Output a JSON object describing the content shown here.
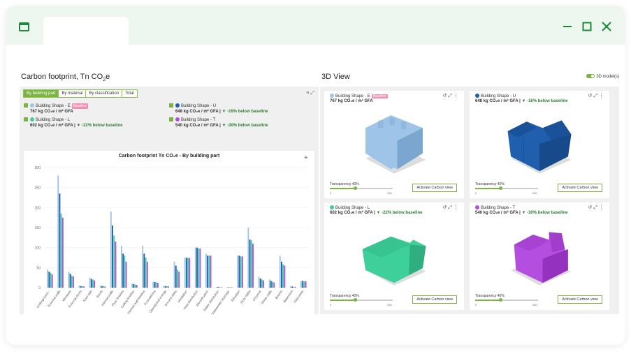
{
  "window": {
    "controls": {
      "minimize": "minimize-icon",
      "maximize": "maximize-icon",
      "close": "close-icon"
    },
    "accent": "#1b8a3a"
  },
  "left_panel": {
    "title": "Carbon footprint, Tn CO",
    "title_sub": "2",
    "title_suffix": "e",
    "tabs": [
      "By building part",
      "By material",
      "By classification",
      "Total"
    ],
    "active_tab": 0,
    "legend": [
      {
        "name": "Building Shape - E",
        "color": "#9ec4e8",
        "badge": "Baseline",
        "value": "767 kg CO₂e / m² GFA",
        "delta": ""
      },
      {
        "name": "Building Shape - U",
        "color": "#1f5fae",
        "badge": "",
        "value": "648 kg CO₂e / m² GFA | ",
        "delta": "▼ -16% below baseline"
      },
      {
        "name": "Building Shape - L",
        "color": "#3ecf9a",
        "badge": "",
        "value": "602 kg CO₂e / m² GFA | ",
        "delta": "▼ -22% below baseline"
      },
      {
        "name": "Building Shape - T",
        "color": "#b44ee0",
        "badge": "",
        "value": "540 kg CO₂e / m² GFA | ",
        "delta": "▼ -30% below baseline"
      }
    ]
  },
  "chart_data": {
    "type": "bar",
    "title": "Carbon footprint Tn CO₂e - By building part",
    "ylim": [
      0,
      300
    ],
    "yticks": [
      0,
      50,
      100,
      150,
      200,
      250,
      300
    ],
    "categories": [
      "Underground...",
      "External walls",
      "Windows",
      "External doors",
      "Roof slab",
      "Roofs",
      "Internal walls",
      "Floor finishes",
      "Ceiling finishes",
      "Internal wall finishes",
      "Foundations",
      "Operational energy",
      "Ground slabs",
      "Ventilation",
      "Heat distribution",
      "Electrification",
      "Water distribution",
      "Wastewater drainage",
      "Elevation",
      "Floor slabs",
      "Columns",
      "Shear walls",
      "Beams",
      "Basement",
      "Staircases"
    ],
    "series": [
      {
        "color": "#9ec4e8",
        "values": [
          45,
          280,
          40,
          5,
          25,
          5,
          190,
          105,
          10,
          105,
          15,
          5,
          65,
          75,
          100,
          85,
          2,
          1,
          80,
          150,
          27,
          20,
          80,
          3,
          17
        ]
      },
      {
        "color": "#1f5fae",
        "values": [
          40,
          235,
          35,
          4,
          22,
          4,
          155,
          85,
          9,
          85,
          14,
          4,
          55,
          75,
          100,
          80,
          2,
          1,
          80,
          120,
          23,
          17,
          65,
          3,
          17
        ]
      },
      {
        "color": "#3ecf9a",
        "values": [
          37,
          185,
          30,
          4,
          20,
          4,
          130,
          80,
          8,
          75,
          13,
          4,
          45,
          74,
          98,
          80,
          1,
          1,
          78,
          118,
          20,
          15,
          58,
          2,
          16
        ]
      },
      {
        "color": "#b44ee0",
        "values": [
          33,
          175,
          28,
          3,
          18,
          3,
          115,
          65,
          7,
          65,
          12,
          3,
          40,
          74,
          98,
          80,
          1,
          1,
          78,
          110,
          18,
          13,
          55,
          2,
          16
        ]
      }
    ],
    "grid": true,
    "legend": "none"
  },
  "right_panel": {
    "title": "3D View",
    "toggle_label": "3D model(s)",
    "cards": [
      {
        "name": "Building Shape - E",
        "badge": "Baseline",
        "color": "#9ec4e8",
        "dark": "#7aa6cf",
        "value": "767 kg CO₂e / m² GFA",
        "delta": "",
        "transparency": "Transparency 40%",
        "min": "0",
        "max": "100",
        "level": 0.4,
        "button": "Activate Carbon view",
        "shape": "E"
      },
      {
        "name": "Building Shape - U",
        "badge": "",
        "color": "#1f5fae",
        "dark": "#164a8a",
        "value": "648 kg CO₂e / m² GFA | ",
        "delta": "▼ -16% below baseline",
        "transparency": "Transparency 40%",
        "min": "0",
        "max": "100",
        "level": 0.4,
        "button": "Activate Carbon view",
        "shape": "U"
      },
      {
        "name": "Building Shape - L",
        "badge": "",
        "color": "#3ecf9a",
        "dark": "#2fae7f",
        "value": "602 kg CO₂e / m² GFA | ",
        "delta": "▼ -22% below baseline",
        "transparency": "Transparency 40%",
        "min": "0",
        "max": "100",
        "level": 0.4,
        "button": "Activate Carbon view",
        "shape": "L"
      },
      {
        "name": "Building Shape - T",
        "badge": "",
        "color": "#b44ee0",
        "dark": "#9432bf",
        "value": "540 kg CO₂e / m² GFA | ",
        "delta": "▼ -30% below baseline",
        "transparency": "Transparency 40%",
        "min": "0",
        "max": "100",
        "level": 0.4,
        "button": "Activate Carbon view",
        "shape": "T"
      }
    ]
  }
}
